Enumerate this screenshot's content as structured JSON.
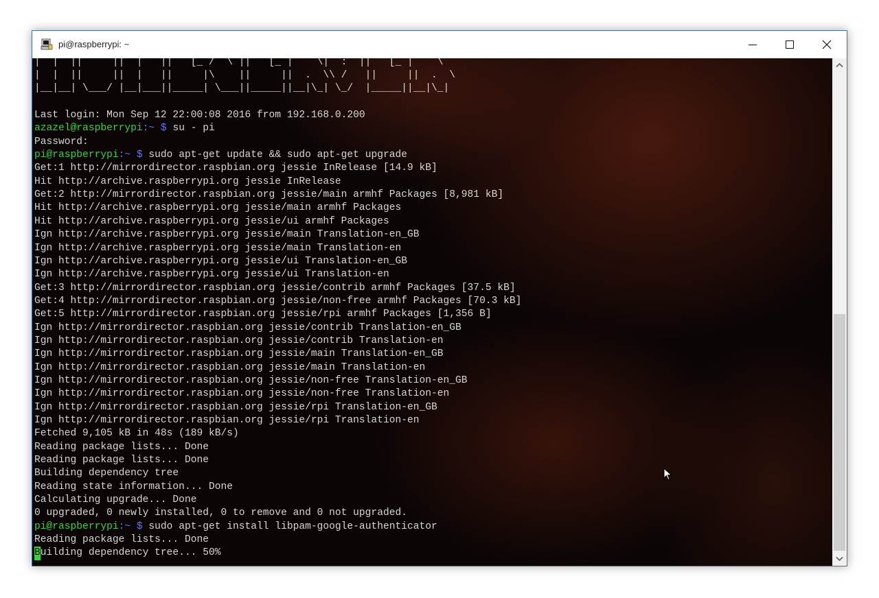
{
  "window": {
    "title": "pi@raspberrypi: ~",
    "icons": {
      "app": "putty-terminal-icon",
      "minimize": "minimize-icon",
      "maximize": "maximize-icon",
      "close": "close-icon"
    }
  },
  "colors": {
    "user_prompt": "#3cd13c",
    "dir_prompt": "#6272ff",
    "text": "#d7d7d7",
    "background": "#0b0505"
  },
  "terminal": {
    "banner": [
      "|  |  ||     ||  |   ||   [_ /  \\ ||   [_ |    \\|  :  ||   [_ |    \\",
      "|  |  ||     ||  |   ||     |\\    ||     ||  .  \\\\ /   ||     ||  .  \\",
      "|__|__| \\___/ |__|___||_____| \\___||_____||__|\\_| \\_/  |_____||__|\\_|"
    ],
    "lines": [
      {
        "text": ""
      },
      {
        "text": "Last login: Mon Sep 12 22:00:08 2016 from 192.168.0.200"
      },
      {
        "user": "azazel@raspberrypi",
        "sep": ":",
        "dir": "~ $",
        "cmd": " su - pi"
      },
      {
        "text": "Password:"
      },
      {
        "user": "pi@raspberrypi",
        "sep": ":",
        "dir": "~ $",
        "cmd": " sudo apt-get update && sudo apt-get upgrade"
      },
      {
        "text": "Get:1 http://mirrordirector.raspbian.org jessie InRelease [14.9 kB]"
      },
      {
        "text": "Hit http://archive.raspberrypi.org jessie InRelease"
      },
      {
        "text": "Get:2 http://mirrordirector.raspbian.org jessie/main armhf Packages [8,981 kB]"
      },
      {
        "text": "Hit http://archive.raspberrypi.org jessie/main armhf Packages"
      },
      {
        "text": "Hit http://archive.raspberrypi.org jessie/ui armhf Packages"
      },
      {
        "text": "Ign http://archive.raspberrypi.org jessie/main Translation-en_GB"
      },
      {
        "text": "Ign http://archive.raspberrypi.org jessie/main Translation-en"
      },
      {
        "text": "Ign http://archive.raspberrypi.org jessie/ui Translation-en_GB"
      },
      {
        "text": "Ign http://archive.raspberrypi.org jessie/ui Translation-en"
      },
      {
        "text": "Get:3 http://mirrordirector.raspbian.org jessie/contrib armhf Packages [37.5 kB]"
      },
      {
        "text": "Get:4 http://mirrordirector.raspbian.org jessie/non-free armhf Packages [70.3 kB]"
      },
      {
        "text": "Get:5 http://mirrordirector.raspbian.org jessie/rpi armhf Packages [1,356 B]"
      },
      {
        "text": "Ign http://mirrordirector.raspbian.org jessie/contrib Translation-en_GB"
      },
      {
        "text": "Ign http://mirrordirector.raspbian.org jessie/contrib Translation-en"
      },
      {
        "text": "Ign http://mirrordirector.raspbian.org jessie/main Translation-en_GB"
      },
      {
        "text": "Ign http://mirrordirector.raspbian.org jessie/main Translation-en"
      },
      {
        "text": "Ign http://mirrordirector.raspbian.org jessie/non-free Translation-en_GB"
      },
      {
        "text": "Ign http://mirrordirector.raspbian.org jessie/non-free Translation-en"
      },
      {
        "text": "Ign http://mirrordirector.raspbian.org jessie/rpi Translation-en_GB"
      },
      {
        "text": "Ign http://mirrordirector.raspbian.org jessie/rpi Translation-en"
      },
      {
        "text": "Fetched 9,105 kB in 48s (189 kB/s)"
      },
      {
        "text": "Reading package lists... Done"
      },
      {
        "text": "Reading package lists... Done"
      },
      {
        "text": "Building dependency tree"
      },
      {
        "text": "Reading state information... Done"
      },
      {
        "text": "Calculating upgrade... Done"
      },
      {
        "text": "0 upgraded, 0 newly installed, 0 to remove and 0 not upgraded."
      },
      {
        "user": "pi@raspberrypi",
        "sep": ":",
        "dir": "~ $",
        "cmd": " sudo apt-get install libpam-google-authenticator"
      },
      {
        "text": "Reading package lists... Done"
      }
    ],
    "current_line": {
      "cursor_char": "B",
      "rest": "uilding dependency tree... 50%"
    }
  },
  "scrollbar": {
    "up_icon": "scroll-up-arrow-icon",
    "down_icon": "scroll-down-arrow-icon"
  },
  "pointer": {
    "icon": "mouse-pointer-icon"
  }
}
